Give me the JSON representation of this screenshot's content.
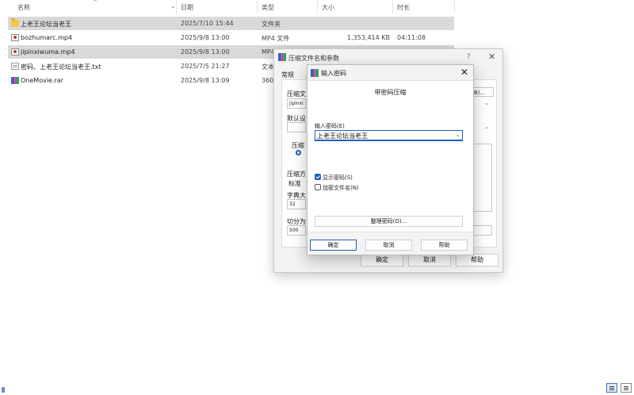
{
  "explorer": {
    "columns": {
      "name": "名称",
      "date": "日期",
      "type": "类型",
      "size": "大小",
      "duration": "时长"
    },
    "files": [
      {
        "icon": "folder-icon",
        "name": "上老王论坛当老王",
        "date": "2025/7/10 15:44",
        "type": "文件夹",
        "size": "",
        "duration": ""
      },
      {
        "icon": "video-file-icon",
        "name": "bozhumarc.mp4",
        "date": "2025/9/8 13:00",
        "type": "MP4 文件",
        "size": "1,353,414 KB",
        "duration": "04:11:08"
      },
      {
        "icon": "video-file-icon",
        "name": "jipinxiwuma.mp4",
        "date": "2025/9/8 13:00",
        "type": "MP4",
        "size": "",
        "duration": ""
      },
      {
        "icon": "text-file-icon",
        "name": "密码、上老王论坛当老王.txt",
        "date": "2025/7/5 21:27",
        "type": "文本",
        "size": "",
        "duration": ""
      },
      {
        "icon": "rar-archive-icon",
        "name": "OneMovie.rar",
        "date": "2025/9/8 13:09",
        "type": "360",
        "size": "",
        "duration": ""
      }
    ]
  },
  "archive_dialog": {
    "title": "压缩文件名和参数",
    "help_icon": "?",
    "tab_general": "常规",
    "archive_name_label": "压缩文",
    "archive_name_value": "jipinxi",
    "browse_label": "B)...",
    "default_profile_label": "默认设",
    "format_group_label": "压缩",
    "method_label": "压缩方",
    "method_value": "标准",
    "dict_label": "字典大",
    "dict_value": "32",
    "split_label": "切分为",
    "split_value": "500",
    "ok": "确定",
    "cancel": "取消",
    "help": "帮助"
  },
  "password_dialog": {
    "title": "输入密码",
    "heading": "带密码压缩",
    "password_label": "输入密码(E)",
    "password_value": "上老王论坛当老王",
    "show_password": {
      "label": "显示密码(S)",
      "checked": true
    },
    "encrypt_filenames": {
      "label": "加密文件名(N)",
      "checked": false
    },
    "organize_button": "整理密码(O)...",
    "ok": "确定",
    "cancel": "取消",
    "help": "帮助"
  }
}
